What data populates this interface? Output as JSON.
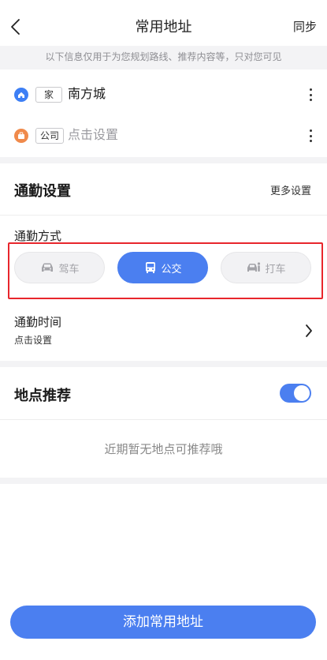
{
  "header": {
    "title": "常用地址",
    "sync_label": "同步",
    "back_icon": "back-chevron-icon"
  },
  "notice": "以下信息仅用于为您规划路线、推荐内容等，只对您可见",
  "addresses": [
    {
      "tag": "家",
      "value": "南方城",
      "icon": "home-icon",
      "icon_color": "#3d7ff5",
      "is_placeholder": false
    },
    {
      "tag": "公司",
      "value": "点击设置",
      "icon": "briefcase-icon",
      "icon_color": "#f08a4b",
      "is_placeholder": true
    }
  ],
  "commute": {
    "title": "通勤设置",
    "more_label": "更多设置",
    "mode_label": "通勤方式",
    "modes": [
      {
        "label": "驾车",
        "icon": "car-icon",
        "selected": false
      },
      {
        "label": "公交",
        "icon": "bus-icon",
        "selected": true
      },
      {
        "label": "打车",
        "icon": "taxi-icon",
        "selected": false
      }
    ],
    "time_label": "通勤时间",
    "time_value": "点击设置"
  },
  "recommend": {
    "title": "地点推荐",
    "enabled": true,
    "empty_text": "近期暂无地点可推荐哦"
  },
  "add_button": "添加常用地址",
  "colors": {
    "accent": "#4b7ff0",
    "highlight_border": "#e8262c",
    "section_bg": "#f3f3f5"
  }
}
